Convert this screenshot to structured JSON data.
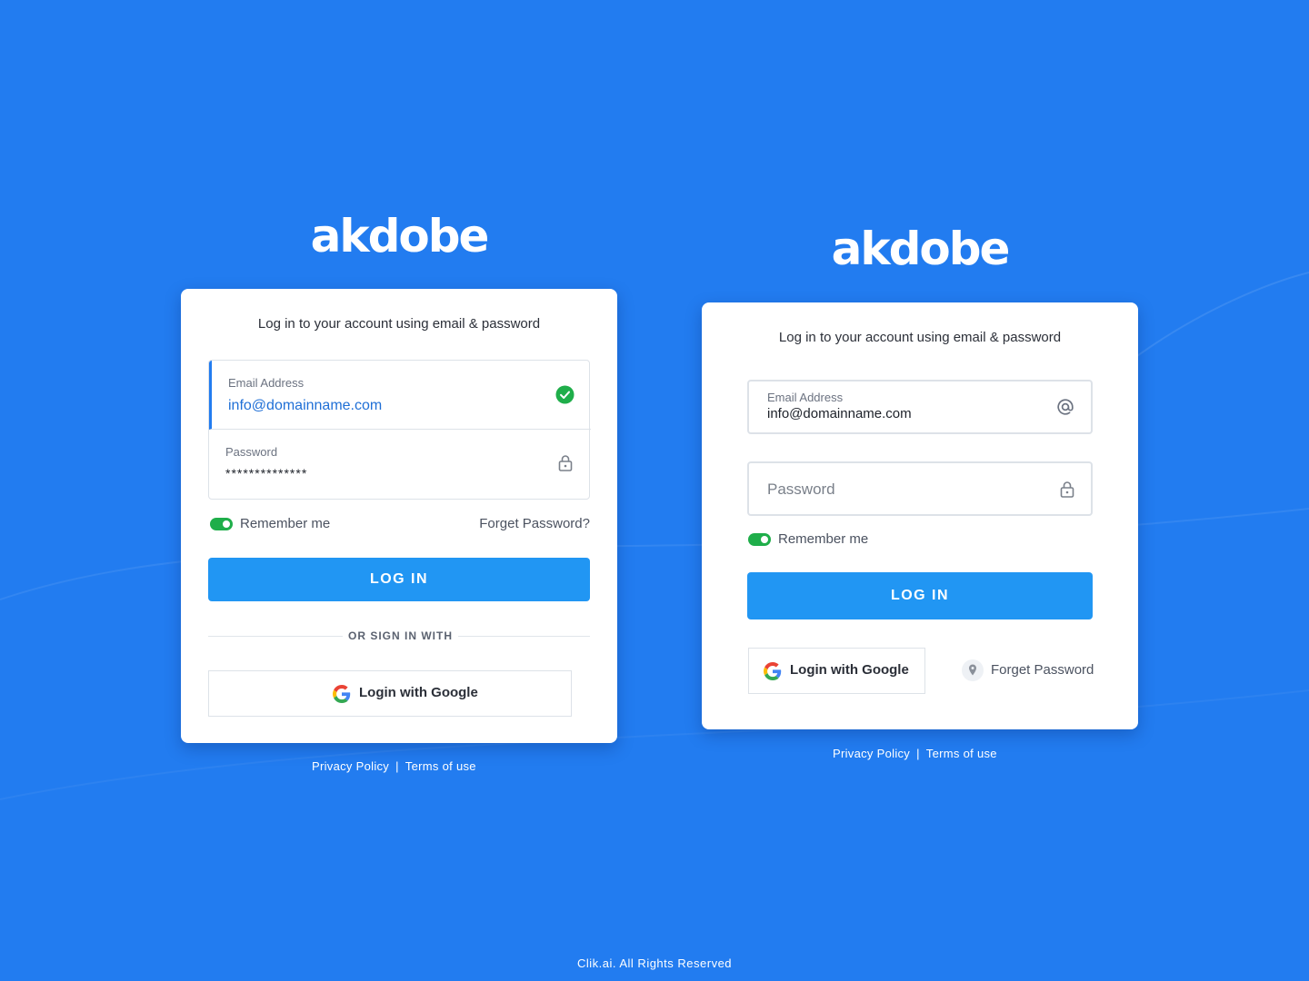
{
  "brand": {
    "logo_text": "akdobe",
    "primary_color": "#2196f3",
    "background_color": "#227cf0",
    "success_color": "#1fae4a"
  },
  "left_card": {
    "subtitle": "Log in to your account using email & password",
    "email": {
      "label": "Email Address",
      "value": "info@domainname.com",
      "status_icon": "check-circle-icon"
    },
    "password": {
      "label": "Password",
      "value": "**************",
      "icon": "lock-icon"
    },
    "remember_me": {
      "label": "Remember me",
      "on": true
    },
    "forgot_password": "Forget Password?",
    "login_button": "LOG IN",
    "divider_text": "OR SIGN IN WITH",
    "google_button": {
      "label": "Login with Google",
      "icon": "google-icon"
    }
  },
  "right_card": {
    "subtitle": "Log in to your account using email & password",
    "email": {
      "label": "Email Address",
      "value": "info@domainname.com",
      "icon": "at-sign-icon"
    },
    "password": {
      "placeholder": "Password",
      "icon": "lock-icon"
    },
    "remember_me": {
      "label": "Remember me",
      "on": true
    },
    "login_button": "LOG IN",
    "google_button": {
      "label": "Login with Google",
      "icon": "google-icon"
    },
    "forgot_password": {
      "label": "Forget Password",
      "icon": "location-pin-icon"
    }
  },
  "footer": {
    "privacy": "Privacy Policy",
    "separator": "|",
    "terms": "Terms of use"
  },
  "copyright": "Clik.ai. All Rights Reserved"
}
